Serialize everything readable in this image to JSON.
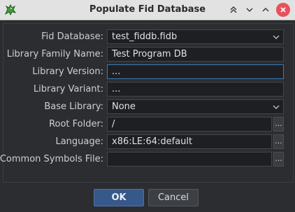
{
  "window": {
    "title": "Populate Fid Database"
  },
  "form": {
    "fid_database": {
      "label": "Fid Database:",
      "value": "test_fiddb.fidb"
    },
    "library_family_name": {
      "label": "Library Family Name:",
      "value": "Test Program DB"
    },
    "library_version": {
      "label": "Library Version:",
      "value": "..."
    },
    "library_variant": {
      "label": "Library Variant:",
      "value": "..."
    },
    "base_library": {
      "label": "Base Library:",
      "value": "None"
    },
    "root_folder": {
      "label": "Root Folder:",
      "value": "/"
    },
    "language": {
      "label": "Language:",
      "value": "x86:LE:64:default"
    },
    "common_symbols_file": {
      "label": "Common Symbols File:",
      "value": ""
    },
    "browse_label": "..."
  },
  "buttons": {
    "ok": "OK",
    "cancel": "Cancel"
  },
  "colors": {
    "accent": "#36588a",
    "focus": "#3d7bb8",
    "close": "#e8505b"
  }
}
